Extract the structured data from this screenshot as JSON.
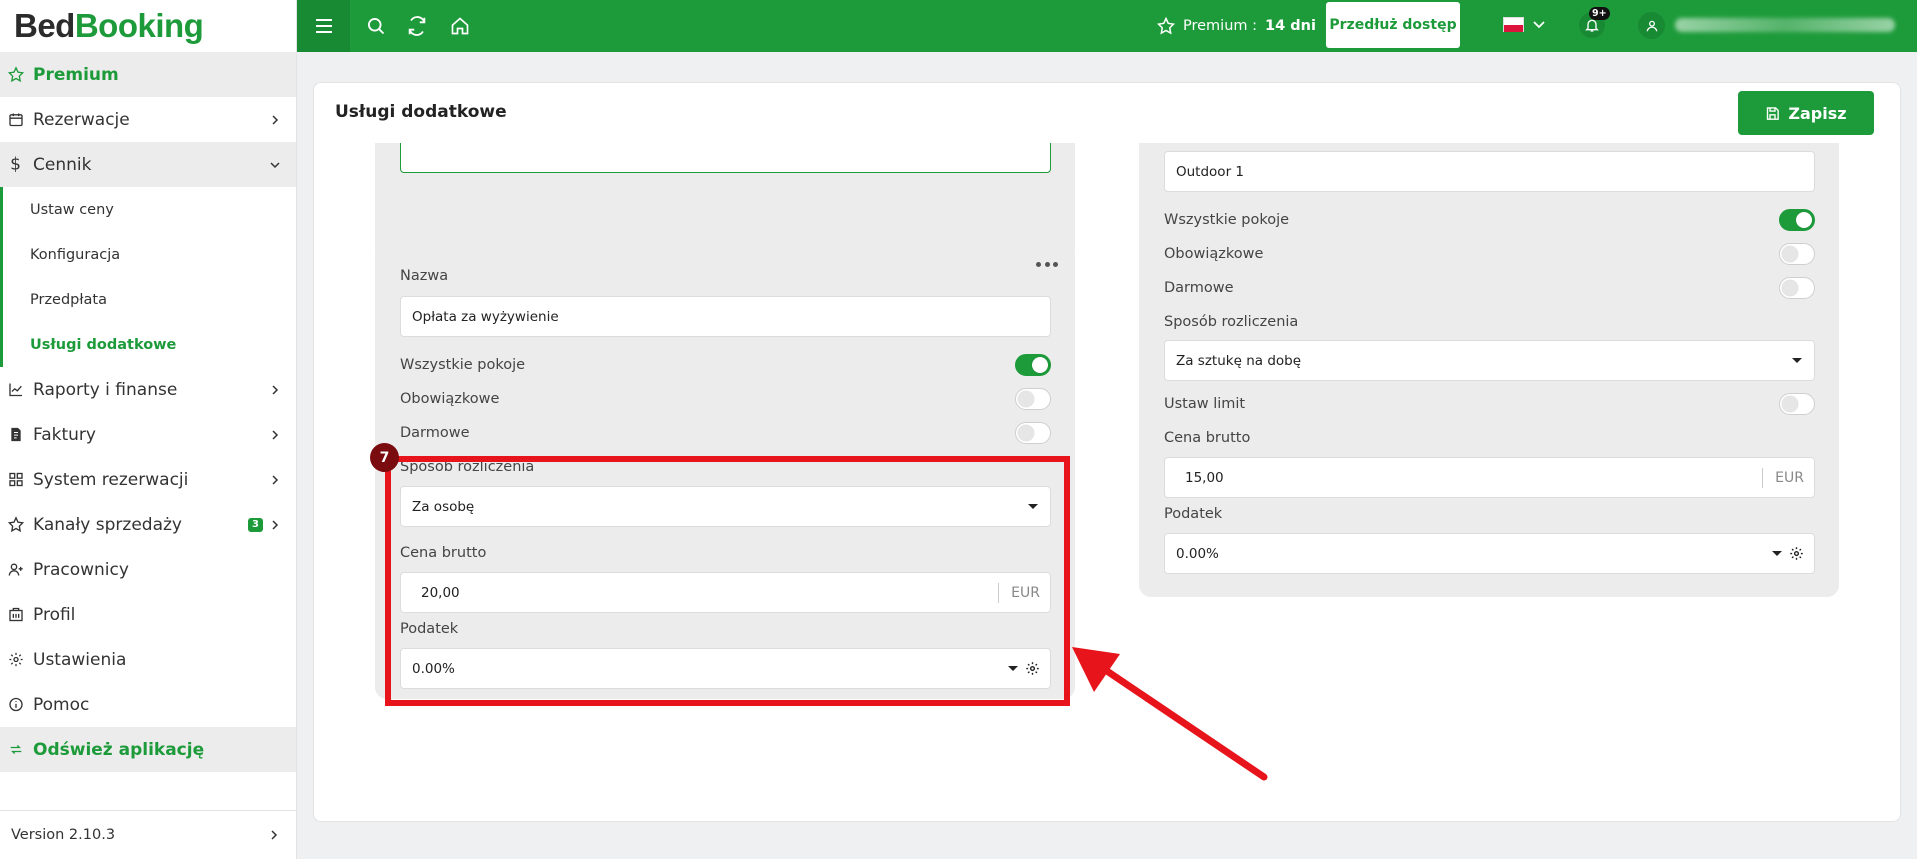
{
  "brand": {
    "part1": "Bed",
    "part2": "Booking"
  },
  "sidebar": {
    "premium": "Premium",
    "items": [
      {
        "label": "Rezerwacje"
      },
      {
        "label": "Cennik"
      },
      {
        "label": "Raporty i finanse"
      },
      {
        "label": "Faktury"
      },
      {
        "label": "System rezerwacji"
      },
      {
        "label": "Kanały sprzedaży",
        "badge": "3"
      },
      {
        "label": "Pracownicy"
      },
      {
        "label": "Profil"
      },
      {
        "label": "Ustawienia"
      },
      {
        "label": "Pomoc"
      }
    ],
    "cennik_sub": [
      "Ustaw ceny",
      "Konfiguracja",
      "Przedpłata",
      "Usługi dodatkowe"
    ],
    "refresh": "Odśwież aplikację",
    "version": "Version 2.10.3"
  },
  "topbar": {
    "premium_label": "Premium :",
    "premium_days": "14 dni",
    "extend_button": "Przedłuż dostęp",
    "notification_count": "9+"
  },
  "page": {
    "title": "Usługi dodatkowe",
    "save_button": "Zapisz"
  },
  "left_service": {
    "name_label": "Nazwa",
    "name_value": "Opłata za wyżywienie",
    "all_rooms_label": "Wszystkie pokoje",
    "all_rooms_on": true,
    "mandatory_label": "Obowiązkowe",
    "mandatory_on": false,
    "free_label": "Darmowe",
    "free_on": false,
    "billing_label": "Sposób rozliczenia",
    "billing_value": "Za osobę",
    "price_label": "Cena brutto",
    "price_value": "20,00",
    "currency": "EUR",
    "tax_label": "Podatek",
    "tax_value": "0.00%"
  },
  "right_service": {
    "name_value": "Outdoor 1",
    "all_rooms_label": "Wszystkie pokoje",
    "all_rooms_on": true,
    "mandatory_label": "Obowiązkowe",
    "mandatory_on": false,
    "free_label": "Darmowe",
    "free_on": false,
    "billing_label": "Sposób rozliczenia",
    "billing_value": "Za sztukę na dobę",
    "limit_label": "Ustaw limit",
    "limit_on": false,
    "price_label": "Cena brutto",
    "price_value": "15,00",
    "currency": "EUR",
    "tax_label": "Podatek",
    "tax_value": "0.00%"
  },
  "annotation": {
    "step": "7"
  },
  "colors": {
    "brand_green": "#1d9b3a",
    "annotation_red": "#e8141b",
    "step_badge": "#7a0c10"
  }
}
